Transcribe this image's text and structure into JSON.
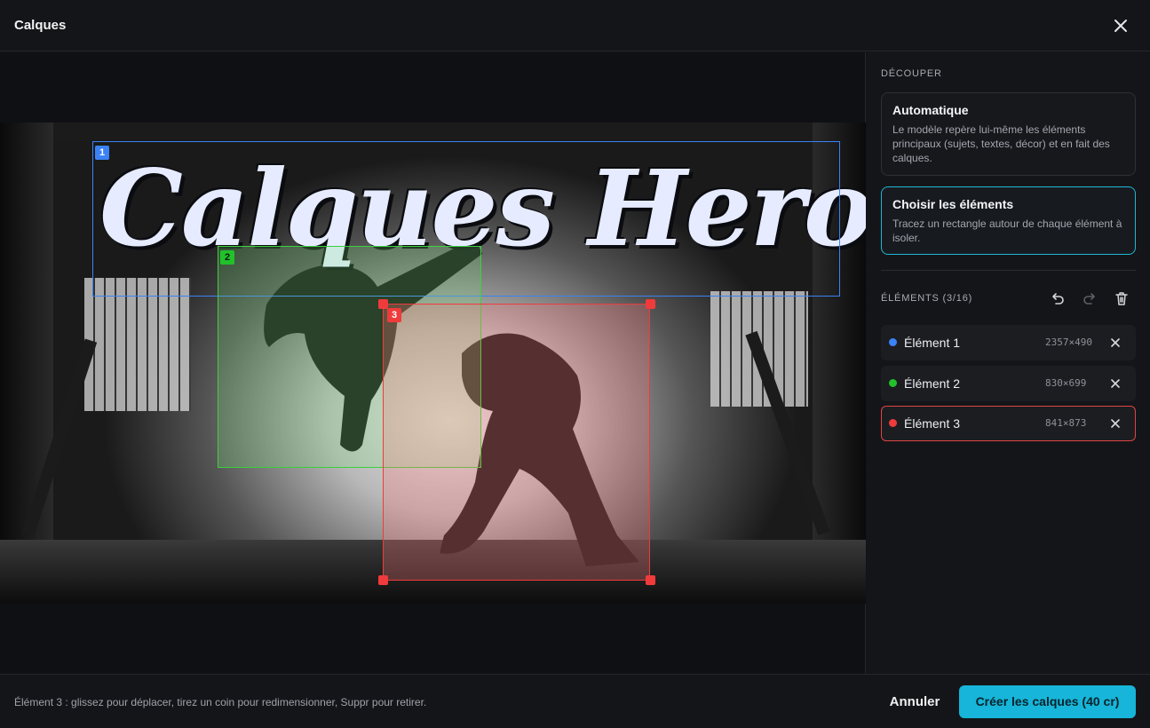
{
  "header": {
    "title": "Calques",
    "close_icon": "close-icon"
  },
  "canvas": {
    "image_title_art": "Calques Heroés",
    "boxes": [
      {
        "tag": "1",
        "color": "#3b82f6"
      },
      {
        "tag": "2",
        "color": "#22c12a"
      },
      {
        "tag": "3",
        "color": "#ef3b3b"
      }
    ]
  },
  "sidebar": {
    "cut_label": "DÉCOUPER",
    "auto": {
      "title": "Automatique",
      "desc": "Le modèle repère lui-même les éléments principaux (sujets, textes, décor) et en fait des calques."
    },
    "manual": {
      "title": "Choisir les éléments",
      "desc": "Tracez un rectangle autour de chaque élément à isoler."
    },
    "elements_label": "ÉLÉMENTS (3/16)",
    "tools": [
      "undo-icon",
      "redo-icon",
      "trash-icon"
    ],
    "elements": [
      {
        "name": "Élément 1",
        "dims": "2357×490",
        "color": "#3b82f6"
      },
      {
        "name": "Élément 2",
        "dims": "830×699",
        "color": "#22c12a"
      },
      {
        "name": "Élément 3",
        "dims": "841×873",
        "color": "#ef3b3b"
      }
    ]
  },
  "footer": {
    "hint": "Élément 3 : glissez pour déplacer, tirez un coin pour redimensionner, Suppr pour retirer.",
    "cancel_label": "Annuler",
    "create_label": "Créer les calques (40 cr)"
  }
}
